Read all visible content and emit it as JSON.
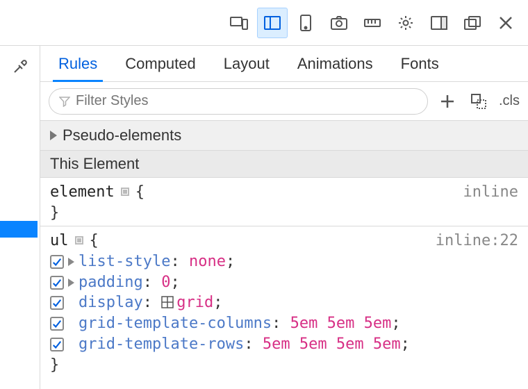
{
  "toolbar": {
    "icons": [
      "rdm-icon",
      "frames-icon",
      "device-icon",
      "screenshot-icon",
      "measure-icon",
      "settings-icon",
      "dock-side-icon",
      "dock-window-icon",
      "close-icon"
    ],
    "active_index": 1
  },
  "eyedropper_icon": "eyedropper-icon",
  "tabs": {
    "items": [
      "Rules",
      "Computed",
      "Layout",
      "Animations",
      "Fonts"
    ],
    "active_index": 0
  },
  "filter": {
    "placeholder": "Filter Styles",
    "add_label": "+",
    "cls_label": ".cls"
  },
  "pseudo": {
    "label": "Pseudo-elements"
  },
  "this_element": {
    "label": "This Element"
  },
  "rules": [
    {
      "selector": "element",
      "source": "inline",
      "decls": []
    },
    {
      "selector": "ul",
      "source": "inline:22",
      "decls": [
        {
          "prop": "list-style",
          "val": "none",
          "expandable": true,
          "grid_icon": false
        },
        {
          "prop": "padding",
          "val": "0",
          "expandable": true,
          "grid_icon": false
        },
        {
          "prop": "display",
          "val": "grid",
          "expandable": false,
          "grid_icon": true
        },
        {
          "prop": "grid-template-columns",
          "val": "5em 5em 5em",
          "expandable": false,
          "grid_icon": false
        },
        {
          "prop": "grid-template-rows",
          "val": "5em 5em 5em 5em",
          "expandable": false,
          "grid_icon": false
        }
      ]
    }
  ]
}
